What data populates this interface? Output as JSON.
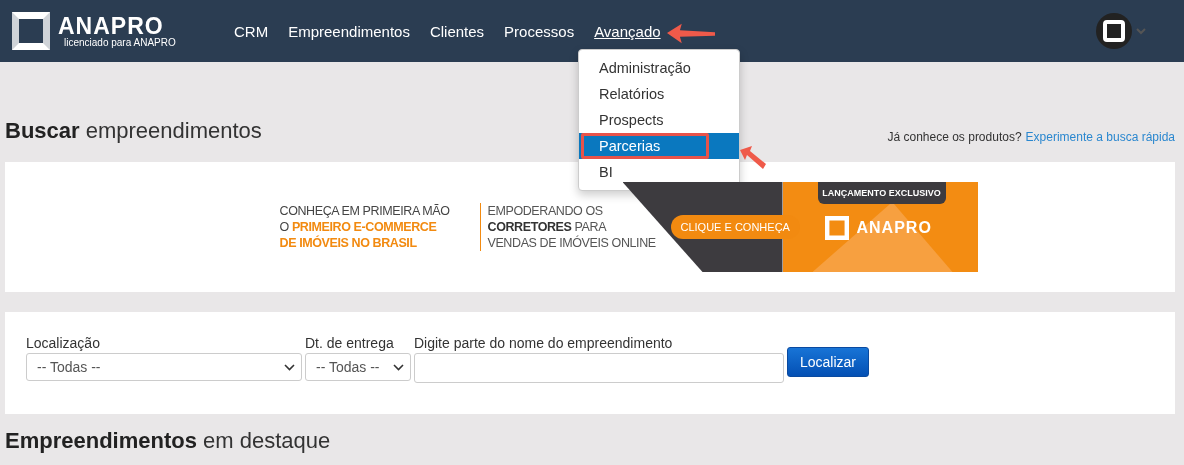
{
  "header": {
    "logo": {
      "name": "ANAPRO",
      "subtitle": "licenciado para ANAPRO"
    },
    "nav": [
      {
        "label": "CRM",
        "selected": false
      },
      {
        "label": "Empreendimentos",
        "selected": false
      },
      {
        "label": "Clientes",
        "selected": false
      },
      {
        "label": "Processos",
        "selected": false
      },
      {
        "label": "Avançado",
        "selected": true
      }
    ]
  },
  "menu": {
    "items": [
      {
        "label": "Administração",
        "selected": false
      },
      {
        "label": "Relatórios",
        "selected": false
      },
      {
        "label": "Prospects",
        "selected": false
      },
      {
        "label": "Parcerias",
        "selected": true
      },
      {
        "label": "BI",
        "selected": false
      }
    ]
  },
  "page_title": "**Buscar** empreendimentos",
  "quick_search": {
    "text": "Já conhece os produtos?",
    "link": "Experimente a busca rápida"
  },
  "banner": {
    "headline": "CONHEÇA EM PRIMEIRA MÃO\nO **PRIMEIRO E-COMMERCE\nDE IMÓVEIS NO BRASIL**",
    "tagline": "EMPODERANDO OS\n**CORRETORES** PARA\nVENDAS DE IMÓVEIS ONLINE",
    "cta": "CLIQUE E CONHEÇA",
    "tab": "LANÇAMENTO EXCLUSIVO",
    "brand": "ANAPRO"
  },
  "search": {
    "fields": [
      {
        "kind": "select",
        "label": "Localização",
        "value": "-- Todas --"
      },
      {
        "kind": "select",
        "label": "Dt. de entrega",
        "value": "-- Todas --"
      },
      {
        "kind": "text",
        "label": "Digite parte do nome do empreendimento"
      }
    ],
    "button": "Localizar"
  },
  "section_title": "**Empreendimentos** em destaque"
}
